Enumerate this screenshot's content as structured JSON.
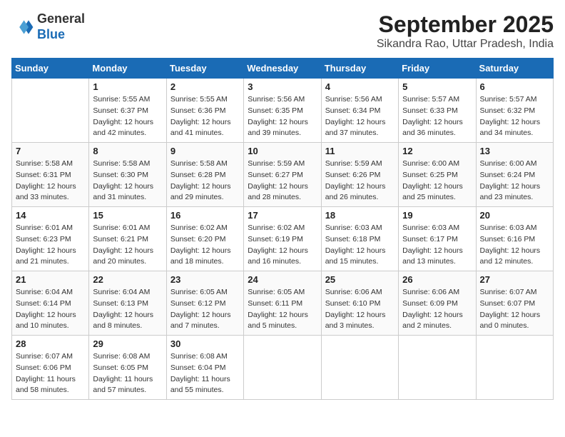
{
  "header": {
    "logo_line1": "General",
    "logo_line2": "Blue",
    "month": "September 2025",
    "location": "Sikandra Rao, Uttar Pradesh, India"
  },
  "days_of_week": [
    "Sunday",
    "Monday",
    "Tuesday",
    "Wednesday",
    "Thursday",
    "Friday",
    "Saturday"
  ],
  "weeks": [
    [
      {
        "day": "",
        "info": ""
      },
      {
        "day": "1",
        "info": "Sunrise: 5:55 AM\nSunset: 6:37 PM\nDaylight: 12 hours\nand 42 minutes."
      },
      {
        "day": "2",
        "info": "Sunrise: 5:55 AM\nSunset: 6:36 PM\nDaylight: 12 hours\nand 41 minutes."
      },
      {
        "day": "3",
        "info": "Sunrise: 5:56 AM\nSunset: 6:35 PM\nDaylight: 12 hours\nand 39 minutes."
      },
      {
        "day": "4",
        "info": "Sunrise: 5:56 AM\nSunset: 6:34 PM\nDaylight: 12 hours\nand 37 minutes."
      },
      {
        "day": "5",
        "info": "Sunrise: 5:57 AM\nSunset: 6:33 PM\nDaylight: 12 hours\nand 36 minutes."
      },
      {
        "day": "6",
        "info": "Sunrise: 5:57 AM\nSunset: 6:32 PM\nDaylight: 12 hours\nand 34 minutes."
      }
    ],
    [
      {
        "day": "7",
        "info": "Sunrise: 5:58 AM\nSunset: 6:31 PM\nDaylight: 12 hours\nand 33 minutes."
      },
      {
        "day": "8",
        "info": "Sunrise: 5:58 AM\nSunset: 6:30 PM\nDaylight: 12 hours\nand 31 minutes."
      },
      {
        "day": "9",
        "info": "Sunrise: 5:58 AM\nSunset: 6:28 PM\nDaylight: 12 hours\nand 29 minutes."
      },
      {
        "day": "10",
        "info": "Sunrise: 5:59 AM\nSunset: 6:27 PM\nDaylight: 12 hours\nand 28 minutes."
      },
      {
        "day": "11",
        "info": "Sunrise: 5:59 AM\nSunset: 6:26 PM\nDaylight: 12 hours\nand 26 minutes."
      },
      {
        "day": "12",
        "info": "Sunrise: 6:00 AM\nSunset: 6:25 PM\nDaylight: 12 hours\nand 25 minutes."
      },
      {
        "day": "13",
        "info": "Sunrise: 6:00 AM\nSunset: 6:24 PM\nDaylight: 12 hours\nand 23 minutes."
      }
    ],
    [
      {
        "day": "14",
        "info": "Sunrise: 6:01 AM\nSunset: 6:23 PM\nDaylight: 12 hours\nand 21 minutes."
      },
      {
        "day": "15",
        "info": "Sunrise: 6:01 AM\nSunset: 6:21 PM\nDaylight: 12 hours\nand 20 minutes."
      },
      {
        "day": "16",
        "info": "Sunrise: 6:02 AM\nSunset: 6:20 PM\nDaylight: 12 hours\nand 18 minutes."
      },
      {
        "day": "17",
        "info": "Sunrise: 6:02 AM\nSunset: 6:19 PM\nDaylight: 12 hours\nand 16 minutes."
      },
      {
        "day": "18",
        "info": "Sunrise: 6:03 AM\nSunset: 6:18 PM\nDaylight: 12 hours\nand 15 minutes."
      },
      {
        "day": "19",
        "info": "Sunrise: 6:03 AM\nSunset: 6:17 PM\nDaylight: 12 hours\nand 13 minutes."
      },
      {
        "day": "20",
        "info": "Sunrise: 6:03 AM\nSunset: 6:16 PM\nDaylight: 12 hours\nand 12 minutes."
      }
    ],
    [
      {
        "day": "21",
        "info": "Sunrise: 6:04 AM\nSunset: 6:14 PM\nDaylight: 12 hours\nand 10 minutes."
      },
      {
        "day": "22",
        "info": "Sunrise: 6:04 AM\nSunset: 6:13 PM\nDaylight: 12 hours\nand 8 minutes."
      },
      {
        "day": "23",
        "info": "Sunrise: 6:05 AM\nSunset: 6:12 PM\nDaylight: 12 hours\nand 7 minutes."
      },
      {
        "day": "24",
        "info": "Sunrise: 6:05 AM\nSunset: 6:11 PM\nDaylight: 12 hours\nand 5 minutes."
      },
      {
        "day": "25",
        "info": "Sunrise: 6:06 AM\nSunset: 6:10 PM\nDaylight: 12 hours\nand 3 minutes."
      },
      {
        "day": "26",
        "info": "Sunrise: 6:06 AM\nSunset: 6:09 PM\nDaylight: 12 hours\nand 2 minutes."
      },
      {
        "day": "27",
        "info": "Sunrise: 6:07 AM\nSunset: 6:07 PM\nDaylight: 12 hours\nand 0 minutes."
      }
    ],
    [
      {
        "day": "28",
        "info": "Sunrise: 6:07 AM\nSunset: 6:06 PM\nDaylight: 11 hours\nand 58 minutes."
      },
      {
        "day": "29",
        "info": "Sunrise: 6:08 AM\nSunset: 6:05 PM\nDaylight: 11 hours\nand 57 minutes."
      },
      {
        "day": "30",
        "info": "Sunrise: 6:08 AM\nSunset: 6:04 PM\nDaylight: 11 hours\nand 55 minutes."
      },
      {
        "day": "",
        "info": ""
      },
      {
        "day": "",
        "info": ""
      },
      {
        "day": "",
        "info": ""
      },
      {
        "day": "",
        "info": ""
      }
    ]
  ]
}
